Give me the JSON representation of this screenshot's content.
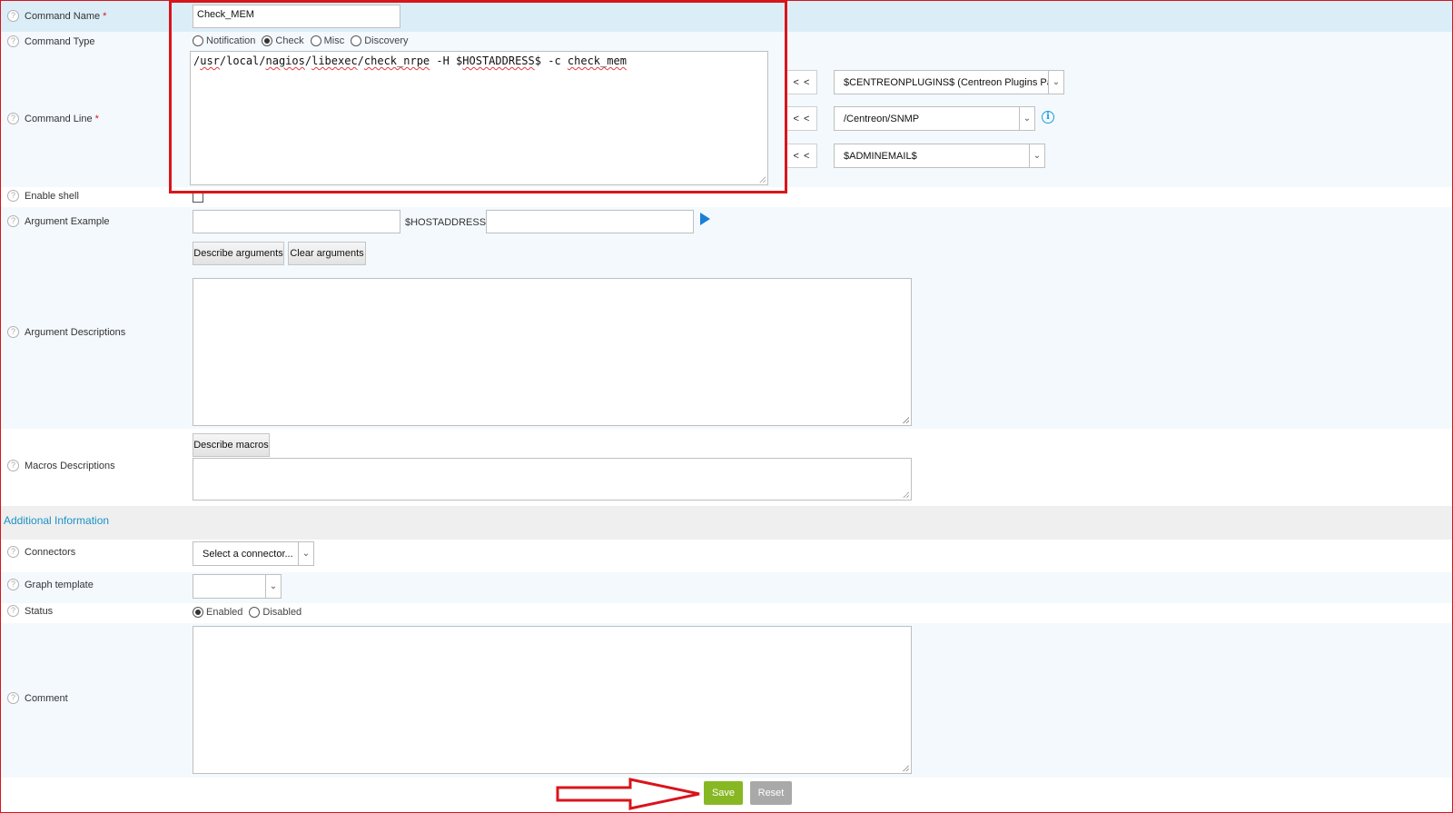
{
  "form": {
    "command_name": {
      "label": "Command Name",
      "required_mark": "*",
      "value": "Check_MEM"
    },
    "command_type": {
      "label": "Command Type",
      "options": [
        {
          "label": "Notification",
          "selected": false
        },
        {
          "label": "Check",
          "selected": true
        },
        {
          "label": "Misc",
          "selected": false
        },
        {
          "label": "Discovery",
          "selected": false
        }
      ]
    },
    "command_line": {
      "label": "Command Line",
      "required_mark": "*",
      "value_parts": [
        "/",
        "usr",
        "/local/",
        "nagios",
        "/",
        "libexec",
        "/",
        "check_nrpe",
        " -H $",
        "HOSTADDRESS",
        "$ -c ",
        "check_mem"
      ],
      "insert_button": "< <",
      "selects": [
        {
          "value": "$CENTREONPLUGINS$ (Centreon Plugins Path)"
        },
        {
          "value": "/Centreon/SNMP"
        },
        {
          "value": "$ADMINEMAIL$"
        }
      ],
      "info_icon": "info-icon"
    },
    "enable_shell": {
      "label": "Enable shell",
      "checked": false
    },
    "argument_example": {
      "label": "Argument Example",
      "value": "",
      "macro": "$HOSTADDRESS$",
      "macro_value": ""
    },
    "argument_buttons": {
      "describe": "Describe arguments",
      "clear": "Clear arguments"
    },
    "argument_descriptions": {
      "label": "Argument Descriptions",
      "value": ""
    },
    "macros": {
      "button": "Describe macros",
      "label": "Macros Descriptions",
      "value": ""
    }
  },
  "additional": {
    "title": "Additional Information",
    "connectors": {
      "label": "Connectors",
      "value": "Select a connector..."
    },
    "graph_template": {
      "label": "Graph template",
      "value": ""
    },
    "status": {
      "label": "Status",
      "options": [
        {
          "label": "Enabled",
          "selected": true
        },
        {
          "label": "Disabled",
          "selected": false
        }
      ]
    },
    "comment": {
      "label": "Comment",
      "value": ""
    }
  },
  "actions": {
    "save": "Save",
    "reset": "Reset"
  },
  "icons": {
    "help": "help-icon",
    "run": "play-icon",
    "dropdown": "chevron-down-icon",
    "annotation_arrow": "arrow-right-icon"
  },
  "colors": {
    "accent": "#1a92c6",
    "save": "#87b824",
    "reset": "#a9a9a9",
    "annotation": "#d9141b",
    "row_highlight": "#dbeef8"
  }
}
